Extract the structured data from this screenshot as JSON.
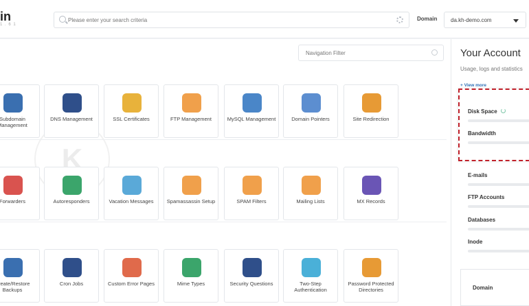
{
  "header": {
    "logo_text": "in",
    "logo_sub": "1 . 6 1",
    "search_placeholder": "Please enter your search criteria",
    "domain_label": "Domain",
    "domain_value": "da.kh-demo.com"
  },
  "main": {
    "nav_filter_placeholder": "Navigation Filter",
    "tiles": [
      {
        "label": "Subdomain Management",
        "icon": "subdomain-icon",
        "color": "#3a6fb0"
      },
      {
        "label": "DNS Management",
        "icon": "dns-icon",
        "color": "#2f4f8a"
      },
      {
        "label": "SSL Certificates",
        "icon": "ssl-certificate-icon",
        "color": "#e8b23b"
      },
      {
        "label": "FTP Management",
        "icon": "ftp-icon",
        "color": "#f0a04b"
      },
      {
        "label": "MySQL Management",
        "icon": "mysql-icon",
        "color": "#4a86c8"
      },
      {
        "label": "Domain Pointers",
        "icon": "domain-pointer-icon",
        "color": "#5c8ed0"
      },
      {
        "label": "Site Redirection",
        "icon": "signpost-icon",
        "color": "#e79a35"
      },
      {
        "label": "Forwarders",
        "icon": "forwarder-icon",
        "color": "#d9534f"
      },
      {
        "label": "Autoresponders",
        "icon": "autoresponder-icon",
        "color": "#3ba56b"
      },
      {
        "label": "Vacation Messages",
        "icon": "vacation-icon",
        "color": "#5aa9d8"
      },
      {
        "label": "Spamassassin Setup",
        "icon": "spam-envelope-icon",
        "color": "#f0a04b"
      },
      {
        "label": "SPAM Filters",
        "icon": "spam-filter-icon",
        "color": "#f0a04b"
      },
      {
        "label": "Mailing Lists",
        "icon": "mailing-list-icon",
        "color": "#f0a04b"
      },
      {
        "label": "MX Records",
        "icon": "mx-record-icon",
        "color": "#6a55b5"
      },
      {
        "label": "Create/Restore Backups",
        "icon": "backup-icon",
        "color": "#3a6fb0"
      },
      {
        "label": "Cron Jobs",
        "icon": "robot-icon",
        "color": "#2f4f8a"
      },
      {
        "label": "Custom Error Pages",
        "icon": "error-page-icon",
        "color": "#e06a4b"
      },
      {
        "label": "Mime Types",
        "icon": "mime-types-icon",
        "color": "#3ba56b"
      },
      {
        "label": "Security Questions",
        "icon": "lock-icon",
        "color": "#2f4f8a"
      },
      {
        "label": "Two-Step Authentication",
        "icon": "two-step-auth-icon",
        "color": "#4ab0d8"
      },
      {
        "label": "Password Protected Directories",
        "icon": "password-folder-icon",
        "color": "#e79a35"
      }
    ]
  },
  "panel": {
    "title": "Your Account",
    "subtitle": "Usage, logs and statistics",
    "view_more": "+ View more",
    "disk_space": "Disk Space",
    "bandwidth": "Bandwidth",
    "emails": "E-mails",
    "ftp_accounts": "FTP Accounts",
    "databases": "Databases",
    "inode": "Inode",
    "domain_card": "Domain"
  },
  "colors": {
    "highlight_border": "#c0202a",
    "link": "#2c6fb5"
  }
}
